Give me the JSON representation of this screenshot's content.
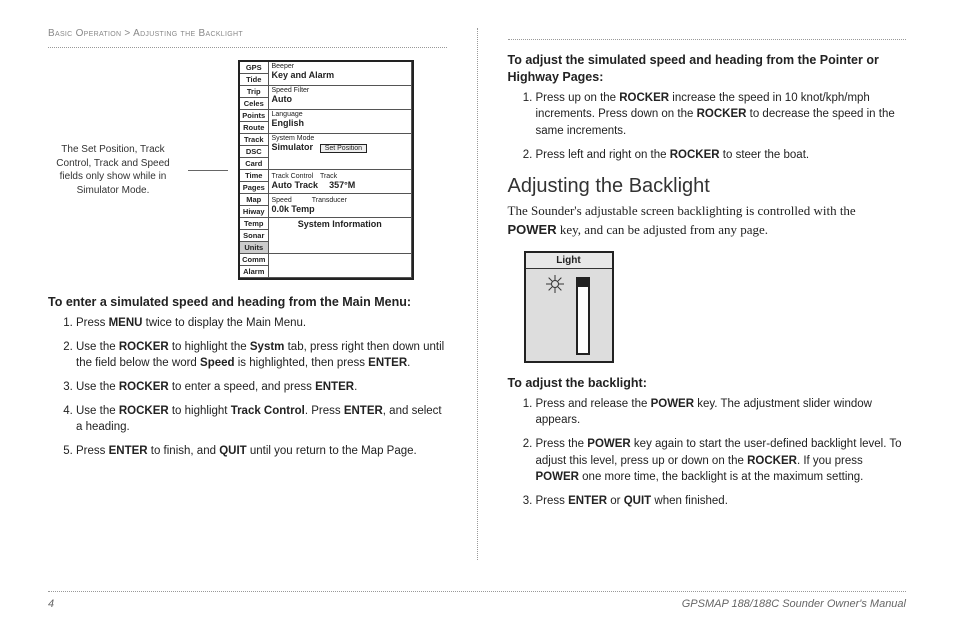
{
  "breadcrumb": {
    "section": "Basic Operation",
    "sep": ">",
    "sub": "Adjusting the Backlight"
  },
  "annotation": "The Set Position, Track Control, Track and Speed fields only show while in Simulator Mode.",
  "gps": {
    "tabs": [
      "GPS",
      "Tide",
      "Trip",
      "Celes",
      "Points",
      "Route",
      "Track",
      "DSC",
      "Card",
      "Time",
      "Pages",
      "Map",
      "Hiway",
      "Temp",
      "Sonar",
      "Units",
      "Comm",
      "Alarm"
    ],
    "rows": {
      "beeper_label": "Beeper",
      "beeper_value": "Key and Alarm",
      "speedfilter_label": "Speed Filter",
      "speedfilter_value": "Auto",
      "language_label": "Language",
      "language_value": "English",
      "sysmode_label": "System Mode",
      "sysmode_value": "Simulator",
      "setpos_btn": "Set Position",
      "trackctrl_label": "Track Control",
      "track_label": "Track",
      "trackctrl_value": "Auto Track",
      "track_value": "357°M",
      "speed_label": "Speed",
      "transducer_label": "Transducer",
      "speed_value": "0.0k",
      "temp_value": "Temp",
      "sysinfo": "System Information"
    }
  },
  "left": {
    "lead": "To enter a simulated speed and heading from the Main Menu:",
    "steps": [
      {
        "pre": "Press ",
        "b1": "MENU",
        "post": " twice to display the Main Menu."
      },
      {
        "pre": "Use the ",
        "b1": "ROCKER",
        "mid1": " to highlight the ",
        "b2": "Systm",
        "mid2": " tab, press right then down until the field below the word ",
        "b3": "Speed",
        "mid3": " is highlighted, then press ",
        "b4": "ENTER",
        "post": "."
      },
      {
        "pre": "Use the ",
        "b1": "ROCKER",
        "mid1": " to enter a speed, and press ",
        "b2": "ENTER",
        "post": "."
      },
      {
        "pre": "Use the ",
        "b1": "ROCKER",
        "mid1": " to highlight ",
        "b2": "Track Control",
        "mid2": ". Press ",
        "b3": "ENTER",
        "post": ", and select a heading."
      },
      {
        "pre": "Press ",
        "b1": "ENTER",
        "mid1": " to finish, and ",
        "b2": "QUIT",
        "post": " until you return to the Map Page."
      }
    ]
  },
  "right": {
    "lead1": "To adjust the simulated speed and heading from the Pointer or Highway Pages:",
    "steps1": [
      {
        "pre": "Press up on the ",
        "b1": "ROCKER",
        "mid1": " increase the speed in 10 knot/kph/mph increments. Press down on the ",
        "b2": "ROCKER",
        "post": " to decrease the speed in the same increments."
      },
      {
        "pre": "Press left and right on the ",
        "b1": "ROCKER",
        "post": " to steer the boat."
      }
    ],
    "heading": "Adjusting the Backlight",
    "body_pre": "The Sounder's adjustable screen backlighting is controlled with the ",
    "body_bold": "POWER",
    "body_post": " key, and can be adjusted from any page.",
    "light_title": "Light",
    "lead2": "To adjust the backlight:",
    "steps2": [
      {
        "pre": "Press and release the ",
        "b1": "POWER",
        "post": " key. The adjustment slider window appears."
      },
      {
        "pre": "Press the ",
        "b1": "POWER",
        "mid1": " key again to start the user-defined backlight level. To adjust this level, press up or down on the ",
        "b2": "ROCKER",
        "mid2": ". If you press ",
        "b3": "POWER",
        "post": " one more time, the backlight is at the maximum setting."
      },
      {
        "pre": "Press ",
        "b1": "ENTER",
        "mid1": " or ",
        "b2": "QUIT",
        "post": " when finished."
      }
    ]
  },
  "footer": {
    "page": "4",
    "title": "GPSMAP 188/188C Sounder Owner's Manual"
  }
}
